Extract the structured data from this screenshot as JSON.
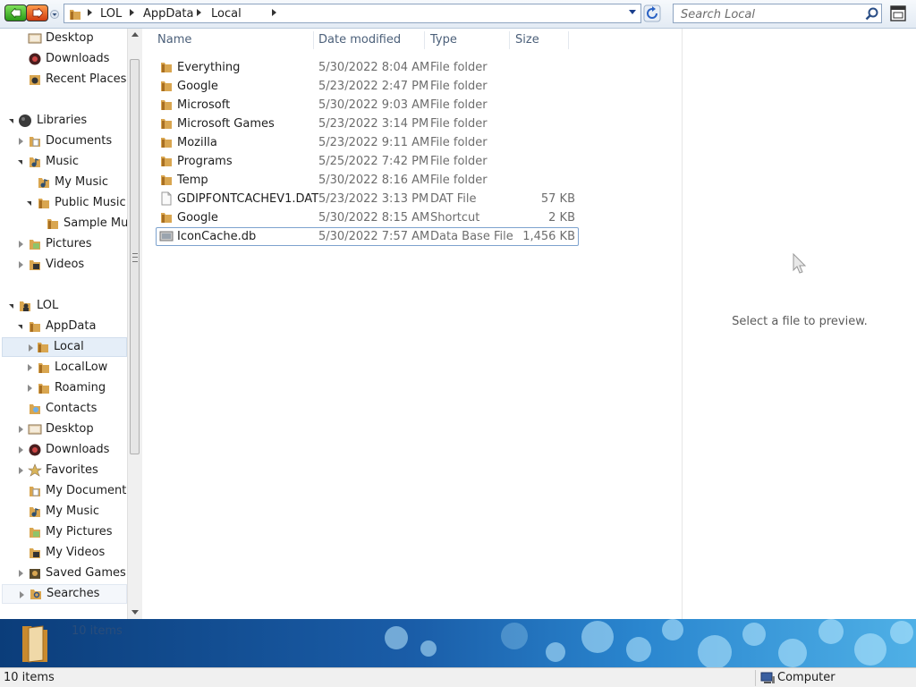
{
  "toolbar": {
    "breadcrumbs": [
      "LOL",
      "AppData",
      "Local"
    ],
    "search_placeholder": "Search Local"
  },
  "nav": {
    "items": [
      {
        "label": "Desktop",
        "icon": "desktop-icon"
      },
      {
        "label": "Downloads",
        "icon": "downloads-icon"
      },
      {
        "label": "Recent Places",
        "icon": "recent-places-icon"
      },
      {
        "label": "Libraries",
        "icon": "libraries-icon"
      },
      {
        "label": "Documents",
        "icon": "documents-icon"
      },
      {
        "label": "Music",
        "icon": "music-icon"
      },
      {
        "label": "My Music",
        "icon": "music-icon"
      },
      {
        "label": "Public Music",
        "icon": "folder-icon"
      },
      {
        "label": "Sample Music",
        "icon": "folder-icon"
      },
      {
        "label": "Pictures",
        "icon": "pictures-icon"
      },
      {
        "label": "Videos",
        "icon": "videos-icon"
      },
      {
        "label": "LOL",
        "icon": "user-icon"
      },
      {
        "label": "AppData",
        "icon": "folder-icon"
      },
      {
        "label": "Local",
        "icon": "folder-icon"
      },
      {
        "label": "LocalLow",
        "icon": "folder-icon"
      },
      {
        "label": "Roaming",
        "icon": "folder-icon"
      },
      {
        "label": "Contacts",
        "icon": "contacts-icon"
      },
      {
        "label": "Desktop",
        "icon": "desktop-icon"
      },
      {
        "label": "Downloads",
        "icon": "downloads-icon"
      },
      {
        "label": "Favorites",
        "icon": "favorites-icon"
      },
      {
        "label": "My Documents",
        "icon": "documents-icon"
      },
      {
        "label": "My Music",
        "icon": "music-icon"
      },
      {
        "label": "My Pictures",
        "icon": "pictures-icon"
      },
      {
        "label": "My Videos",
        "icon": "videos-icon"
      },
      {
        "label": "Saved Games",
        "icon": "saved-games-icon"
      },
      {
        "label": "Searches",
        "icon": "searches-icon"
      }
    ]
  },
  "list": {
    "columns": [
      "Name",
      "Date modified",
      "Type",
      "Size"
    ],
    "rows": [
      {
        "name": "Everything",
        "date": "5/30/2022 8:04 AM",
        "type": "File folder",
        "size": "",
        "icon": "folder-icon"
      },
      {
        "name": "Google",
        "date": "5/23/2022 2:47 PM",
        "type": "File folder",
        "size": "",
        "icon": "folder-icon"
      },
      {
        "name": "Microsoft",
        "date": "5/30/2022 9:03 AM",
        "type": "File folder",
        "size": "",
        "icon": "folder-icon"
      },
      {
        "name": "Microsoft Games",
        "date": "5/23/2022 3:14 PM",
        "type": "File folder",
        "size": "",
        "icon": "folder-icon"
      },
      {
        "name": "Mozilla",
        "date": "5/23/2022 9:11 AM",
        "type": "File folder",
        "size": "",
        "icon": "folder-icon"
      },
      {
        "name": "Programs",
        "date": "5/25/2022 7:42 PM",
        "type": "File folder",
        "size": "",
        "icon": "folder-icon"
      },
      {
        "name": "Temp",
        "date": "5/30/2022 8:16 AM",
        "type": "File folder",
        "size": "",
        "icon": "folder-icon"
      },
      {
        "name": "GDIPFONTCACHEV1.DAT",
        "date": "5/23/2022 3:13 PM",
        "type": "DAT File",
        "size": "57 KB",
        "icon": "file-icon"
      },
      {
        "name": "Google",
        "date": "5/30/2022 8:15 AM",
        "type": "Shortcut",
        "size": "2 KB",
        "icon": "folder-icon"
      },
      {
        "name": "IconCache.db",
        "date": "5/30/2022 7:57 AM",
        "type": "Data Base File",
        "size": "1,456 KB",
        "icon": "database-icon"
      }
    ]
  },
  "preview": {
    "message": "Select a file to preview."
  },
  "details": {
    "text": "10 items"
  },
  "status": {
    "count": "10 items",
    "zone": "Computer"
  }
}
